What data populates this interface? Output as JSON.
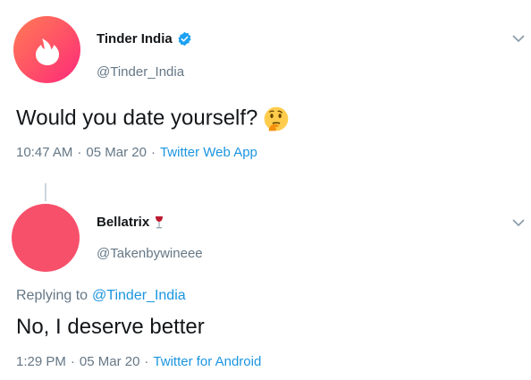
{
  "tweet": {
    "author_name": "Tinder India",
    "author_handle": "@Tinder_India",
    "text": "Would you date yourself?",
    "time": "10:47 AM",
    "date": "05 Mar 20",
    "source": "Twitter Web App",
    "separator": "·"
  },
  "reply": {
    "author_name": "Bellatrix",
    "author_handle": "@Takenbywineee",
    "replying_prefix": "Replying to",
    "replying_to": "@Tinder_India",
    "text": "No, I deserve better",
    "time": "1:29 PM",
    "date": "05 Mar 20",
    "source": "Twitter for Android",
    "separator": "·"
  },
  "colors": {
    "tinder_gradient_start": "#ff5864",
    "tinder_gradient_end": "#fd297b",
    "bellatrix_avatar": "#f7506a",
    "link": "#1b95e0",
    "verified": "#1da1f2"
  },
  "icons": [
    "tinder-flame-icon",
    "verified-badge-icon",
    "thinking-face-emoji",
    "wine-glass-emoji",
    "chevron-down-icon"
  ]
}
